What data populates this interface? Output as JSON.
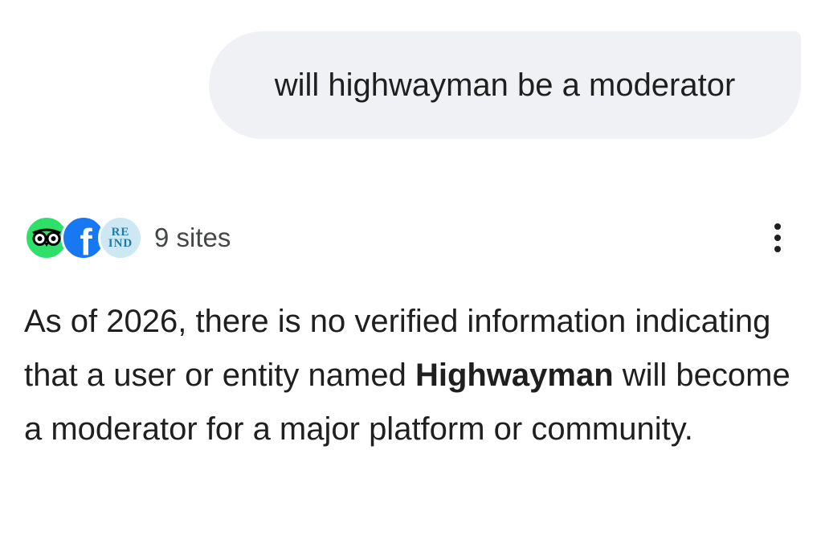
{
  "user_message": {
    "text": "will highwayman be a moderator"
  },
  "sources": {
    "favicons": [
      {
        "icon": "tripadvisor-owl-icon",
        "color": "#2ee06a"
      },
      {
        "icon": "facebook-icon",
        "color": "#1877f2",
        "letter": "f"
      },
      {
        "icon": "remind-icon",
        "color": "#cde8f2",
        "line1": "RE",
        "line2": "IND"
      }
    ],
    "count_label": "9 sites"
  },
  "more_menu": {
    "icon": "more-vert-icon"
  },
  "answer": {
    "part1": "As of 2026, there is no verified information indicating that a user or entity named ",
    "bold": "Highwayman",
    "part2": " will become a moderator for a major platform or community."
  }
}
